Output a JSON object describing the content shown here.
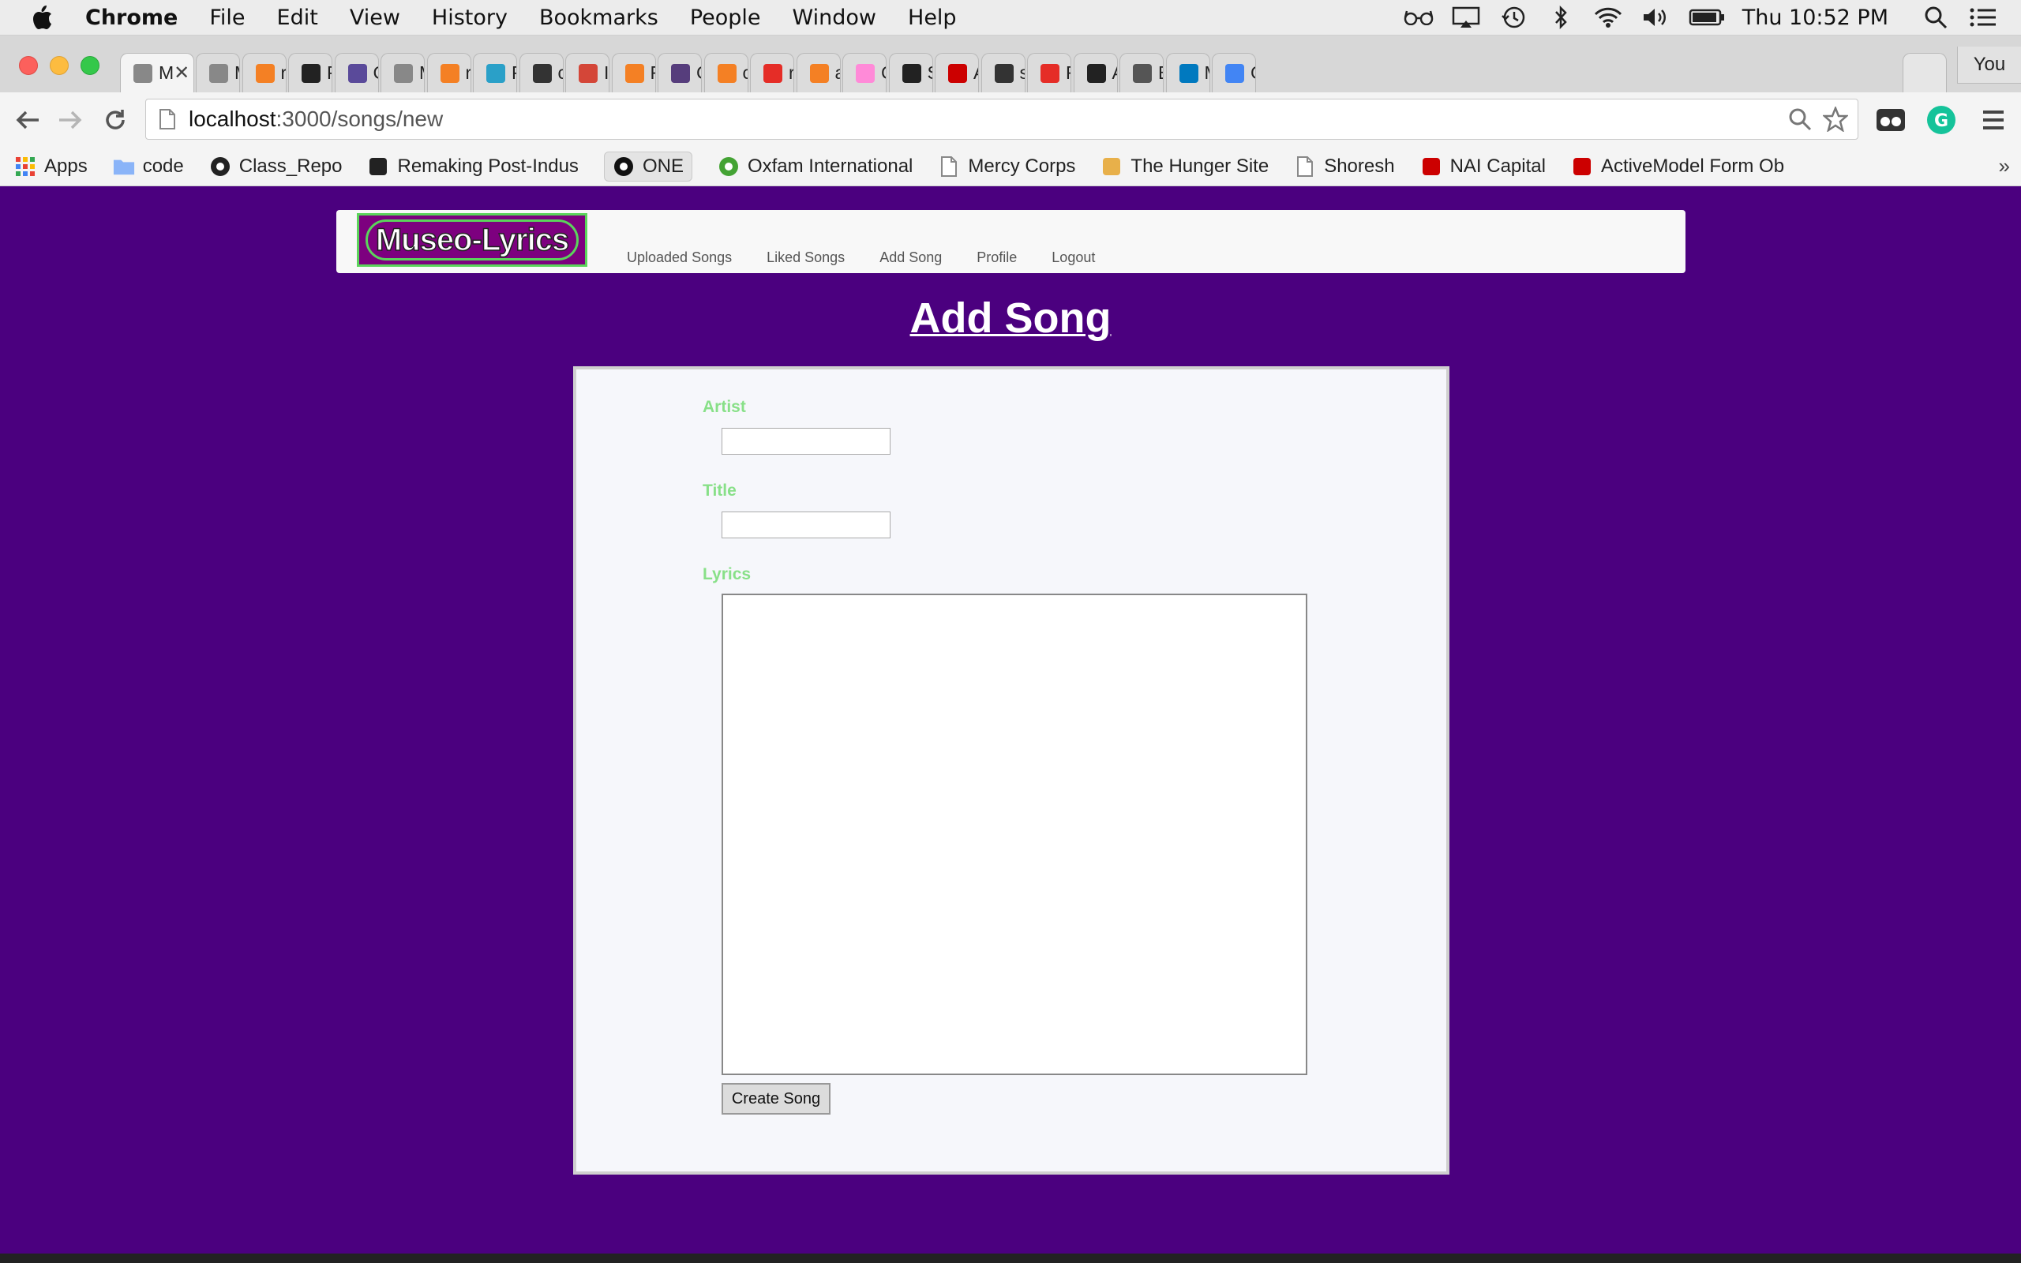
{
  "menubar": {
    "app_name": "Chrome",
    "items": [
      "File",
      "Edit",
      "View",
      "History",
      "Bookmarks",
      "People",
      "Window",
      "Help"
    ],
    "clock": "Thu 10:52 PM"
  },
  "tabs": [
    {
      "label": "M",
      "color": "#888888"
    },
    {
      "label": "Mu",
      "color": "#888888"
    },
    {
      "label": "rul",
      "color": "#f48024"
    },
    {
      "label": "Pa",
      "color": "#222222"
    },
    {
      "label": "Ge",
      "color": "#5a4a9a"
    },
    {
      "label": "Mu",
      "color": "#888888"
    },
    {
      "label": "rul",
      "color": "#f48024"
    },
    {
      "label": "Pa",
      "color": "#2aa0c8"
    },
    {
      "label": "co",
      "color": "#333333"
    },
    {
      "label": "Inl",
      "color": "#d44638"
    },
    {
      "label": "Ru",
      "color": "#f48024"
    },
    {
      "label": "Co",
      "color": "#563d7c"
    },
    {
      "label": "cs",
      "color": "#f48024"
    },
    {
      "label": "rat",
      "color": "#e52d27"
    },
    {
      "label": "ac",
      "color": "#f48024"
    },
    {
      "label": "Cr",
      "color": "#ff8ad8"
    },
    {
      "label": "SE",
      "color": "#222222"
    },
    {
      "label": "Ac",
      "color": "#cc0000"
    },
    {
      "label": "se",
      "color": "#333333"
    },
    {
      "label": "Ra",
      "color": "#e52d27"
    },
    {
      "label": "Al",
      "color": "#222222"
    },
    {
      "label": "Bo",
      "color": "#555555"
    },
    {
      "label": "Mu",
      "color": "#0079bf"
    },
    {
      "label": "Go",
      "color": "#4285f4"
    }
  ],
  "profile_button": "You",
  "address_bar": {
    "host": "localhost",
    "path": ":3000/songs/new"
  },
  "bookmarks": [
    {
      "label": "Apps",
      "icon": "apps-grid-icon",
      "color": "#e94235"
    },
    {
      "label": "code",
      "icon": "folder-icon",
      "color": "#8ab4f8"
    },
    {
      "label": "Class_Repo",
      "icon": "github-icon",
      "color": "#222222"
    },
    {
      "label": "Remaking Post-Indus",
      "icon": "amazon-icon",
      "color": "#222222"
    },
    {
      "label": "ONE",
      "icon": "one-logo-icon",
      "color": "#111111"
    },
    {
      "label": "Oxfam International",
      "icon": "oxfam-icon",
      "color": "#44a334"
    },
    {
      "label": "Mercy Corps",
      "icon": "page-icon",
      "color": "#888888"
    },
    {
      "label": "The Hunger Site",
      "icon": "hunger-site-icon",
      "color": "#e8b04a"
    },
    {
      "label": "Shoresh",
      "icon": "page-icon",
      "color": "#888888"
    },
    {
      "label": "NAI Capital",
      "icon": "nai-icon",
      "color": "#cc0000"
    },
    {
      "label": "ActiveModel Form Ob",
      "icon": "rails-icon",
      "color": "#cc0000"
    }
  ],
  "site": {
    "logo": "Museo-Lyrics",
    "nav": [
      "Uploaded Songs",
      "Liked Songs",
      "Add Song",
      "Profile",
      "Logout"
    ]
  },
  "form": {
    "title": "Add Song",
    "artist_label": "Artist",
    "artist_value": "",
    "title_label": "Title",
    "title_value": "",
    "lyrics_label": "Lyrics",
    "lyrics_value": "",
    "submit_label": "Create Song"
  }
}
